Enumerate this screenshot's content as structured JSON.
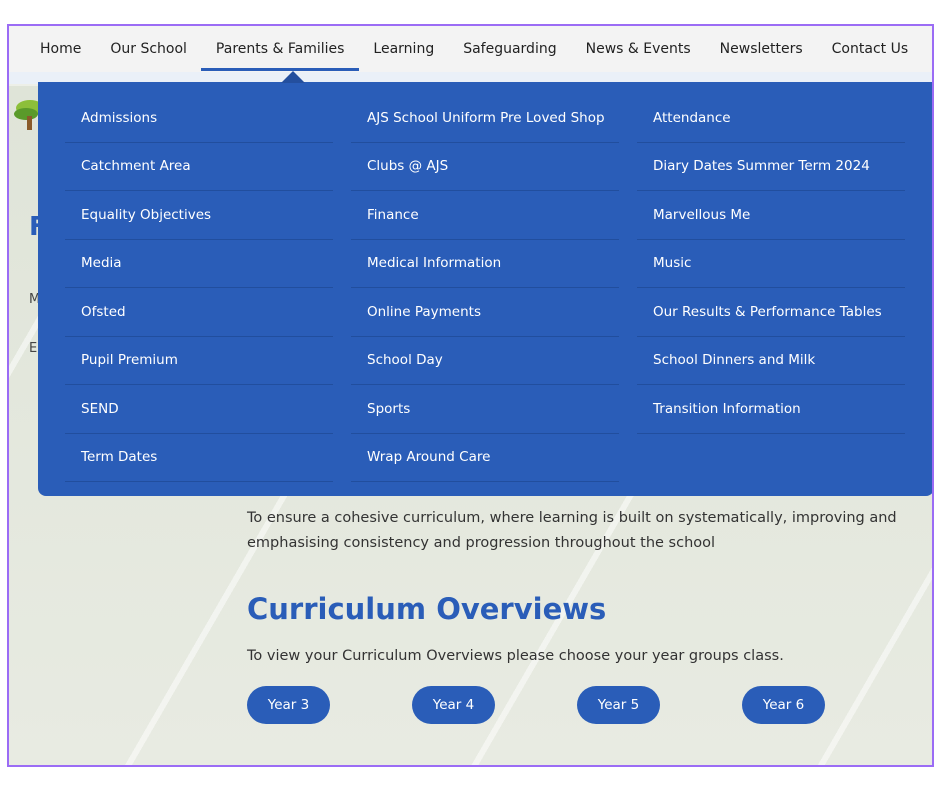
{
  "nav": [
    "Home",
    "Our School",
    "Parents & Families",
    "Learning",
    "Safeguarding",
    "News & Events",
    "Newsletters",
    "Contact Us"
  ],
  "active_nav": "Parents & Families",
  "dropdown": {
    "col1": [
      "Admissions",
      "Catchment Area",
      "Equality Objectives",
      "Media",
      "Ofsted",
      "Pupil Premium",
      "SEND",
      "Term Dates"
    ],
    "col2": [
      "AJS School Uniform Pre Loved Shop",
      "Clubs @ AJS",
      "Finance",
      "Medical Information",
      "Online Payments",
      "School Day",
      "Sports",
      "Wrap Around Care"
    ],
    "col3": [
      "Attendance",
      "Diary Dates Summer Term 2024",
      "Marvellous Me",
      "Music",
      "Our Results & Performance Tables",
      "School Dinners and Milk",
      "Transition Information"
    ]
  },
  "main": {
    "intro": "To ensure a cohesive curriculum, where learning is built on systematically, improving and emphasising consistency and progression throughout the school",
    "heading": "Curriculum Overviews",
    "subtext": "To view your Curriculum Overviews please choose your year groups class.",
    "years": [
      "Year 3",
      "Year 4",
      "Year 5",
      "Year 6"
    ]
  },
  "colors": {
    "brand": "#2a5db8"
  }
}
